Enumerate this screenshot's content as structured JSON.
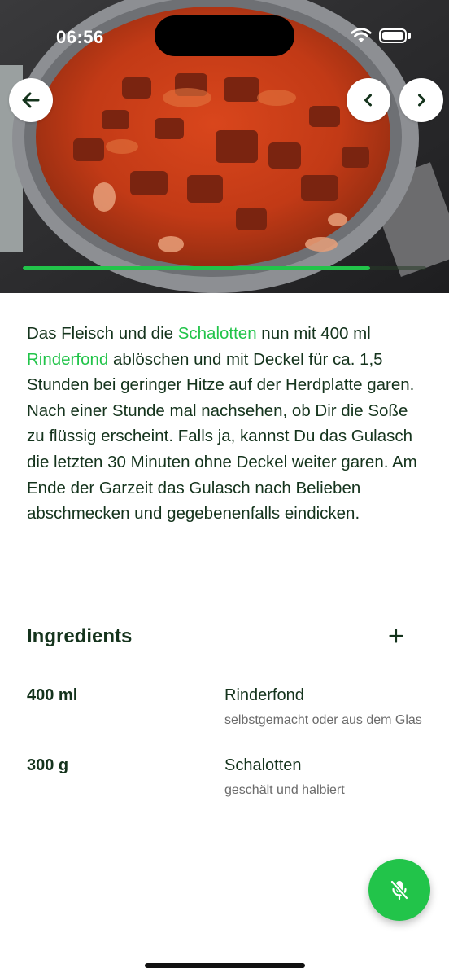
{
  "status_bar": {
    "time": "06:56"
  },
  "step": {
    "segments": [
      {
        "text": "Das Fleisch und die ",
        "highlight": false
      },
      {
        "text": "Schalotten",
        "highlight": true
      },
      {
        "text": " nun mit 400 ml ",
        "highlight": false
      },
      {
        "text": "Rinderfond",
        "highlight": true
      },
      {
        "text": " ablöschen und mit Deckel für ca. 1,5 Stunden bei geringer Hitze auf der Herdplatte garen. Nach einer Stunde mal nachsehen, ob Dir die Soße zu flüssig erscheint. Falls ja, kannst Du das Gulasch die letzten 30 Minuten ohne Deckel weiter garen. Am Ende der Garzeit das Gulasch nach Belieben abschmecken und gegebenenfalls eindicken.",
        "highlight": false
      }
    ],
    "progress": 0.86
  },
  "ingredients": {
    "title": "Ingredients",
    "add_icon": "plus-icon",
    "items": [
      {
        "amount": "400 ml",
        "name": "Rinderfond",
        "note": "selbstgemacht oder aus dem Glas"
      },
      {
        "amount": "300 g",
        "name": "Schalotten",
        "note": "geschält und halbiert"
      }
    ]
  },
  "icons": {
    "back": "arrow-left-icon",
    "prev": "chevron-left-icon",
    "next": "chevron-right-icon",
    "mic": "microphone-off-icon"
  },
  "colors": {
    "accent": "#22c44a",
    "text": "#14331c",
    "muted": "#6b6b6b"
  }
}
